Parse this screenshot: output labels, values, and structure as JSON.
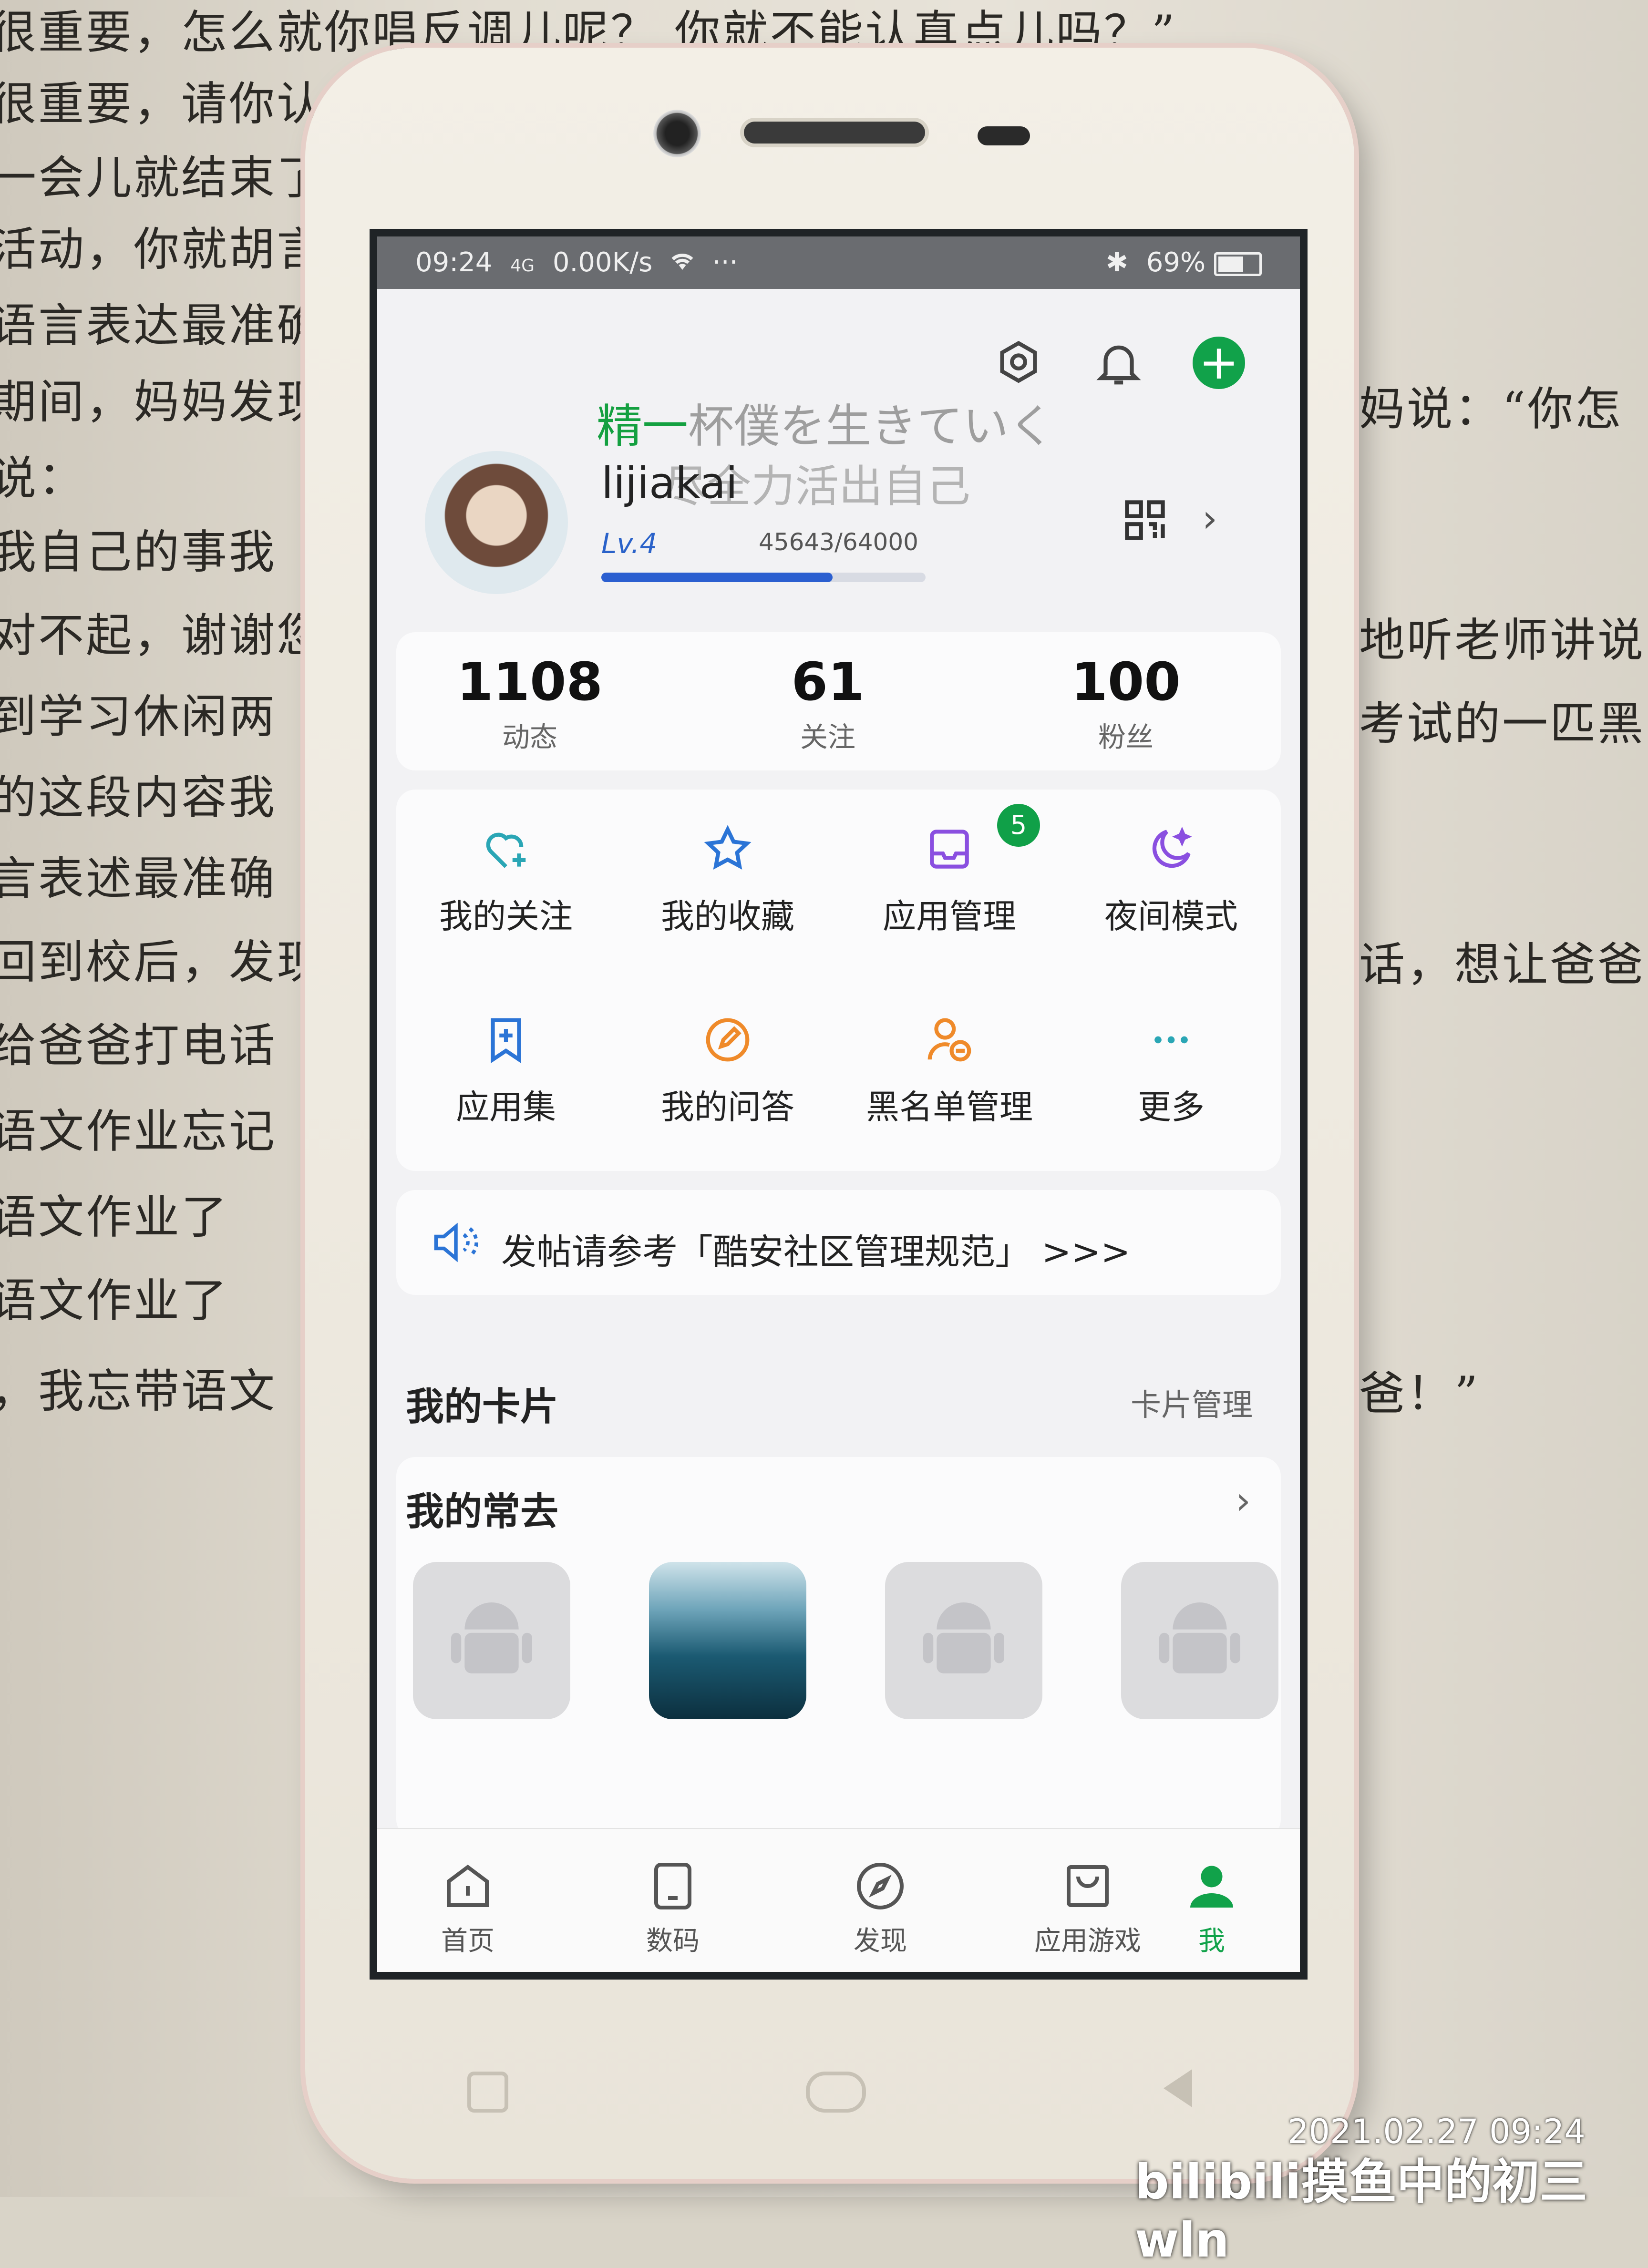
{
  "book_lines_left": [
    "很重要，怎么就你唱反调儿呢？ 你就不能认真点儿吗？”",
    "很重要，请你认",
    "一会儿就结束了",
    "活动，你就胡言",
    "语言表达最准确",
    "期间，妈妈发现",
    "说：",
    "我自己的事我",
    "对不起，谢谢您",
    "到学习休闲两",
    "的这段内容我",
    "言表述最准确",
    "回到校后，发现",
    "给爸爸打电话",
    "语文作业忘记",
    "语文作业了",
    "语文作业了",
    "，我忘带语文"
  ],
  "book_lines_right": [
    "妈说：“你怎",
    "",
    "地听老师讲说",
    "考试的一匹黑",
    "",
    "",
    "话，想让爸爸",
    "",
    "",
    "",
    "爸！”"
  ],
  "status_bar": {
    "time": "09:24",
    "signal": "4G",
    "speed": "0.00K/s",
    "wifi": "wifi-icon",
    "more": "···",
    "battery": "69%"
  },
  "lyrics": {
    "line1_highlight": "精一",
    "line1_rest": "杯僕を生きていく",
    "line2": "尽全力活出自己"
  },
  "profile": {
    "username": "lijiakai",
    "level": "Lv.4",
    "exp": "45643/64000",
    "exp_fraction": 0.713
  },
  "stats": [
    {
      "value": "1108",
      "label": "动态"
    },
    {
      "value": "61",
      "label": "关注"
    },
    {
      "value": "100",
      "label": "粉丝"
    }
  ],
  "menu": [
    {
      "label": "我的关注",
      "icon": "heart-plus-icon"
    },
    {
      "label": "我的收藏",
      "icon": "star-icon"
    },
    {
      "label": "应用管理",
      "icon": "inbox-icon",
      "badge": "5"
    },
    {
      "label": "夜间模式",
      "icon": "moon-icon"
    },
    {
      "label": "应用集",
      "icon": "bookmark-plus-icon"
    },
    {
      "label": "我的问答",
      "icon": "pencil-circle-icon"
    },
    {
      "label": "黑名单管理",
      "icon": "user-block-icon"
    },
    {
      "label": "更多",
      "icon": "more-dots-icon"
    }
  ],
  "notice": "发帖请参考「酷安社区管理规范」 >>>",
  "cards": {
    "title": "我的卡片",
    "manage": "卡片管理"
  },
  "frequent": {
    "title": "我的常去"
  },
  "nav": [
    {
      "label": "首页"
    },
    {
      "label": "数码"
    },
    {
      "label": "发现"
    },
    {
      "label": "应用游戏"
    },
    {
      "label": "我"
    }
  ],
  "watermark": {
    "datetime": "2021.02.27 09:24",
    "author": "bilibili摸鱼中的初三wln"
  },
  "colors": {
    "accent": "#11a24a",
    "level": "#2a62c9",
    "icon_teal": "#2aa6b5",
    "icon_blue": "#2b74d6",
    "icon_purple": "#8a4fe0",
    "icon_orange": "#ef8a2a"
  }
}
